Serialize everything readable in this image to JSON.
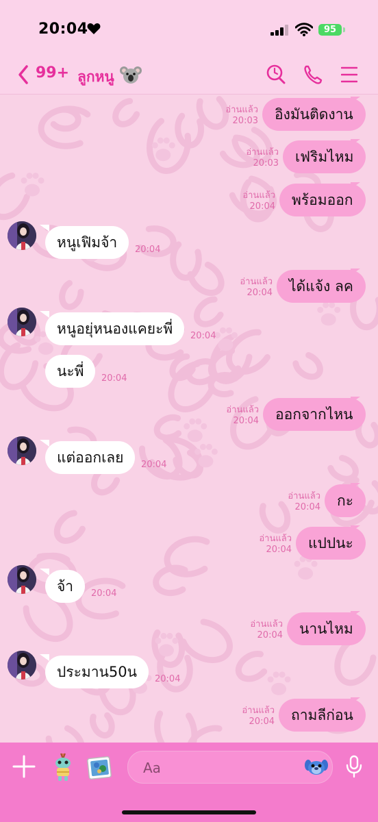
{
  "status_bar": {
    "time": "20:04",
    "battery": "95"
  },
  "header": {
    "unread_count": "99+",
    "title": "ลูกหนู"
  },
  "read_label": "อ่านแล้ว",
  "messages": [
    {
      "dir": "out",
      "text": "อิงมันติดงาน",
      "time": "20:03",
      "read": true
    },
    {
      "dir": "out",
      "text": "เฟริมไหม",
      "time": "20:03",
      "read": true
    },
    {
      "dir": "out",
      "text": "พร้อมออก",
      "time": "20:04",
      "read": true
    },
    {
      "dir": "in",
      "text": "หนูเฟิมจ้า",
      "time": "20:04"
    },
    {
      "dir": "out",
      "text": "ได้แจ้ง ลค",
      "time": "20:04",
      "read": true
    },
    {
      "dir": "in",
      "text": "หนูอยุ่หนองแคยะพี่",
      "time": "20:04"
    },
    {
      "dir": "in",
      "text": "นะพี่",
      "time": "20:04"
    },
    {
      "dir": "out",
      "text": "ออกจากไหน",
      "time": "20:04",
      "read": true
    },
    {
      "dir": "in",
      "text": "แต่ออกเลย",
      "time": "20:04"
    },
    {
      "dir": "out",
      "text": "กะ",
      "time": "20:04",
      "read": true
    },
    {
      "dir": "out",
      "text": "แปปนะ",
      "time": "20:04",
      "read": true
    },
    {
      "dir": "in",
      "text": "จ้า",
      "time": "20:04"
    },
    {
      "dir": "out",
      "text": "นานไหม",
      "time": "20:04",
      "read": true
    },
    {
      "dir": "in",
      "text": "ประมาน50น",
      "time": "20:04"
    },
    {
      "dir": "out",
      "text": "ถามลีก่อน",
      "time": "20:04",
      "read": true
    }
  ],
  "composer": {
    "placeholder": "Aa"
  },
  "colors": {
    "accent": "#e62f9c",
    "bubble_out": "#f9a3d6",
    "bubble_in": "#ffffff",
    "chat_bg": "#f9d2e6",
    "input_bar": "#f47ccc"
  },
  "icons": [
    "back-chevron-icon",
    "koala-emoji-icon",
    "search-icon",
    "phone-icon",
    "menu-icon",
    "plus-icon",
    "sticker-icon",
    "photo-icon",
    "emoji-icon",
    "mic-icon"
  ]
}
